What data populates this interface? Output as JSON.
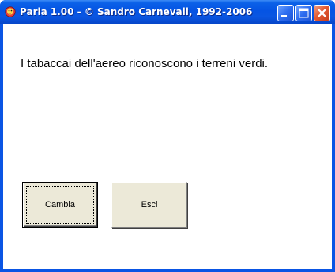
{
  "window": {
    "title": "Parla 1.00 - © Sandro Carnevali, 1992-2006",
    "icon": "app-face-icon",
    "controls": {
      "minimize": "minimize-icon",
      "maximize": "maximize-icon",
      "close": "close-icon"
    }
  },
  "main": {
    "sentence": "I tabaccai dell'aereo riconoscono i terreni verdi.",
    "buttons": {
      "cambia_label": "Cambia",
      "esci_label": "Esci"
    }
  },
  "colors": {
    "titlebar": "#0554e3",
    "frame": "#0a55e4",
    "close_button": "#e35a32",
    "button_face": "#ece9d8",
    "client_background": "#ffffff"
  }
}
